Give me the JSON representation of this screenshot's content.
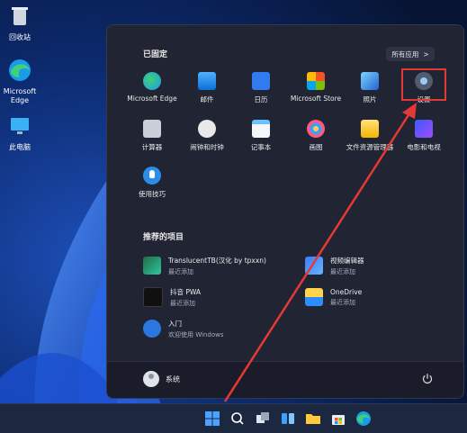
{
  "desktop": {
    "icons": [
      {
        "label": "回收站"
      },
      {
        "label": "Microsoft Edge"
      },
      {
        "label": "此电脑"
      }
    ]
  },
  "start_menu": {
    "pinned_title": "已固定",
    "all_apps_label": "所有应用",
    "all_apps_chevron": ">",
    "pinned": [
      {
        "label": "Microsoft Edge",
        "icon": "edge-icon"
      },
      {
        "label": "邮件",
        "icon": "mail-icon"
      },
      {
        "label": "日历",
        "icon": "calendar-icon"
      },
      {
        "label": "Microsoft Store",
        "icon": "store-icon"
      },
      {
        "label": "照片",
        "icon": "photos-icon"
      },
      {
        "label": "设置",
        "icon": "settings-icon"
      },
      {
        "label": "计算器",
        "icon": "calculator-icon"
      },
      {
        "label": "闹钟和时钟",
        "icon": "clock-icon"
      },
      {
        "label": "记事本",
        "icon": "notepad-icon"
      },
      {
        "label": "画图",
        "icon": "paint-icon"
      },
      {
        "label": "文件资源管理器",
        "icon": "folder-icon"
      },
      {
        "label": "电影和电视",
        "icon": "movies-icon"
      },
      {
        "label": "使用技巧",
        "icon": "tips-icon"
      }
    ],
    "recommended_title": "推荐的项目",
    "recommended": [
      {
        "title": "TranslucentTB(汉化 by tpxxn)",
        "subtitle": "最近添加"
      },
      {
        "title": "视频编辑器",
        "subtitle": "最近添加"
      },
      {
        "title": "抖音 PWA",
        "subtitle": "最近添加"
      },
      {
        "title": "OneDrive",
        "subtitle": "最近添加"
      },
      {
        "title": "入门",
        "subtitle": "欢迎使用 Windows"
      }
    ],
    "user_name": "系统"
  },
  "colors": {
    "start_bg": "#202433",
    "annotation_red": "#e53935",
    "accent_blue": "#2b7cf6"
  }
}
